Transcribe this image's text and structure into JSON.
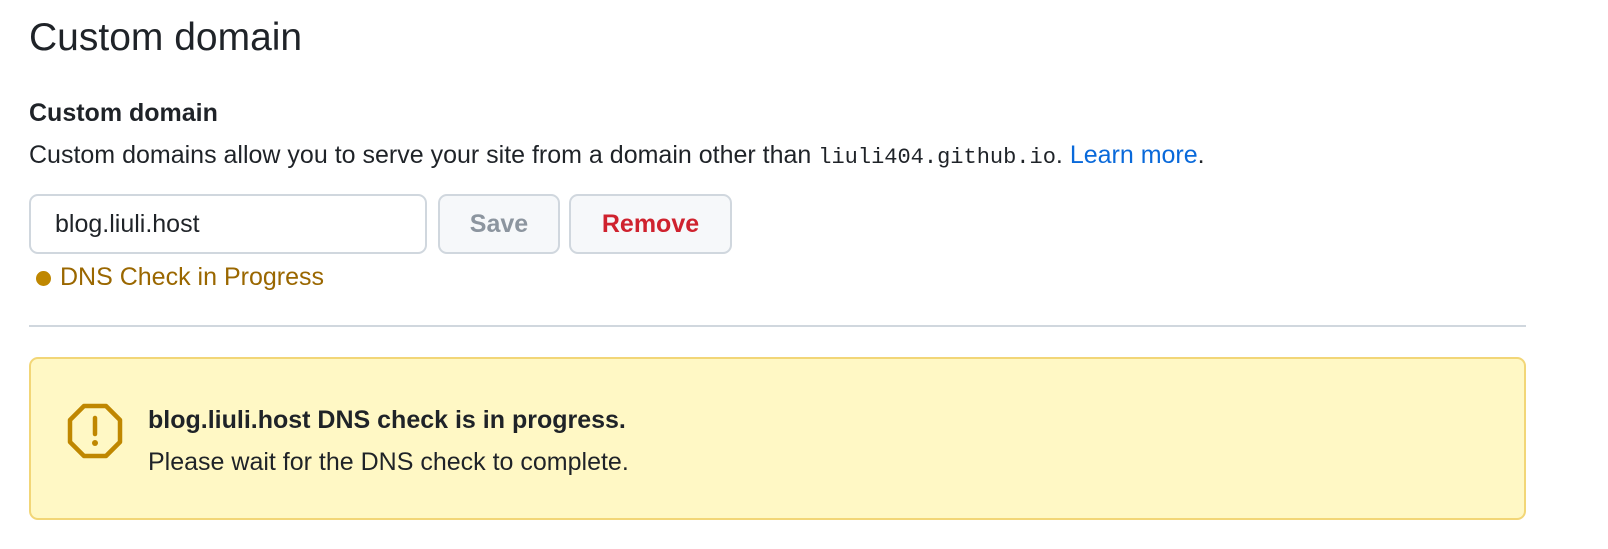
{
  "page": {
    "title": "Custom domain"
  },
  "custom_domain": {
    "heading": "Custom domain",
    "description_prefix": "Custom domains allow you to serve your site from a domain other than ",
    "default_domain": "liuli404.github.io",
    "description_mid": ". ",
    "learn_more_label": "Learn more",
    "description_suffix": ".",
    "input_value": "blog.liuli.host",
    "save_label": "Save",
    "remove_label": "Remove",
    "status_text": "DNS Check in Progress"
  },
  "alert": {
    "icon": "alert-octagon-icon",
    "title": "blog.liuli.host DNS check is in progress.",
    "message": "Please wait for the DNS check to complete."
  },
  "colors": {
    "link": "#0969da",
    "danger": "#cf222e",
    "status_attention": "#9a6700",
    "flash_background": "#fff8c5",
    "flash_border": "#f2d677"
  }
}
